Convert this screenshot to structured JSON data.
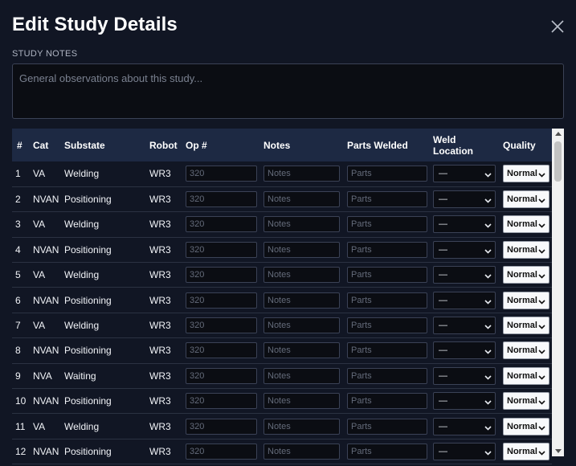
{
  "modal": {
    "title": "Edit Study Details",
    "notes_label": "STUDY NOTES",
    "notes_placeholder": "General observations about this study...",
    "notes_value": ""
  },
  "table": {
    "columns": [
      "#",
      "Cat",
      "Substate",
      "Robot",
      "Op #",
      "Notes",
      "Parts Welded",
      "Weld Location",
      "Quality"
    ],
    "op_placeholder": "320",
    "notes_placeholder": "Notes",
    "parts_placeholder": "Parts",
    "weld_default": "—",
    "quality_default": "Normal",
    "rows": [
      {
        "num": "1",
        "cat": "VA",
        "substate": "Welding",
        "robot": "WR3"
      },
      {
        "num": "2",
        "cat": "NVAN",
        "substate": "Positioning",
        "robot": "WR3"
      },
      {
        "num": "3",
        "cat": "VA",
        "substate": "Welding",
        "robot": "WR3"
      },
      {
        "num": "4",
        "cat": "NVAN",
        "substate": "Positioning",
        "robot": "WR3"
      },
      {
        "num": "5",
        "cat": "VA",
        "substate": "Welding",
        "robot": "WR3"
      },
      {
        "num": "6",
        "cat": "NVAN",
        "substate": "Positioning",
        "robot": "WR3"
      },
      {
        "num": "7",
        "cat": "VA",
        "substate": "Welding",
        "robot": "WR3"
      },
      {
        "num": "8",
        "cat": "NVAN",
        "substate": "Positioning",
        "robot": "WR3"
      },
      {
        "num": "9",
        "cat": "NVA",
        "substate": "Waiting",
        "robot": "WR3"
      },
      {
        "num": "10",
        "cat": "NVAN",
        "substate": "Positioning",
        "robot": "WR3"
      },
      {
        "num": "11",
        "cat": "VA",
        "substate": "Welding",
        "robot": "WR3"
      },
      {
        "num": "12",
        "cat": "NVAN",
        "substate": "Positioning",
        "robot": "WR3"
      }
    ]
  },
  "colors": {
    "background": "#111624",
    "header_row": "#1d2943",
    "input_bg": "#0b0d13",
    "border": "#3b4256"
  },
  "icons": {
    "close": "close-icon",
    "dropdown": "chevron-down-icon"
  }
}
